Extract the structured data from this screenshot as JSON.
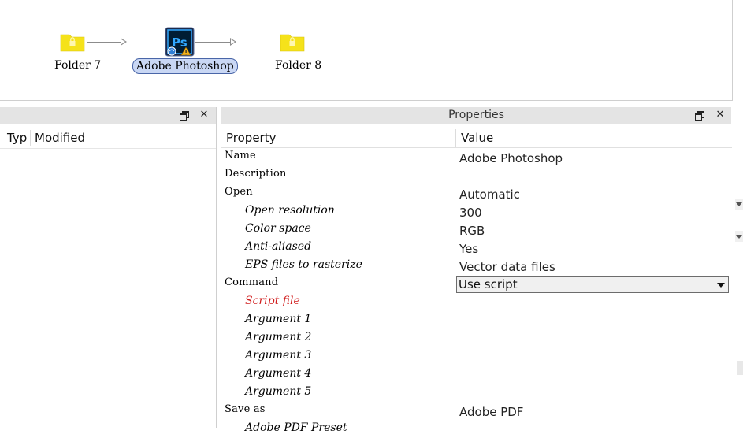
{
  "flow": {
    "nodes": [
      {
        "label": "Folder 7",
        "icon": "folder-lock-icon"
      },
      {
        "label": "Adobe Photoshop",
        "icon": "photoshop-app-icon",
        "selected": true
      },
      {
        "label": "Folder 8",
        "icon": "folder-lock-icon"
      }
    ],
    "folder_color": "#f5e21a",
    "selection_color": "#c9d7f4"
  },
  "left_panel": {
    "columns": [
      "Typ",
      "Modified"
    ]
  },
  "properties_panel": {
    "title": "Properties",
    "col_property": "Property",
    "col_value": "Value",
    "rows": [
      {
        "name": "Name",
        "value": "Adobe Photoshop",
        "kind": "group"
      },
      {
        "name": "Description",
        "value": "",
        "kind": "group"
      },
      {
        "name": "Open",
        "value": "Automatic",
        "kind": "group"
      },
      {
        "name": "Open resolution",
        "value": "300",
        "kind": "child"
      },
      {
        "name": "Color space",
        "value": "RGB",
        "kind": "child"
      },
      {
        "name": "Anti-aliased",
        "value": "Yes",
        "kind": "child"
      },
      {
        "name": "EPS files to rasterize",
        "value": "Vector data files",
        "kind": "child"
      },
      {
        "name": "Command",
        "value": "Use script",
        "kind": "group",
        "dropdown": true
      },
      {
        "name": "Script file",
        "value": "",
        "kind": "child",
        "error": true
      },
      {
        "name": "Argument 1",
        "value": "",
        "kind": "child"
      },
      {
        "name": "Argument 2",
        "value": "",
        "kind": "child"
      },
      {
        "name": "Argument 3",
        "value": "",
        "kind": "child"
      },
      {
        "name": "Argument 4",
        "value": "",
        "kind": "child"
      },
      {
        "name": "Argument 5",
        "value": "",
        "kind": "child"
      },
      {
        "name": "Save as",
        "value": "Adobe PDF",
        "kind": "group"
      },
      {
        "name": "Adobe PDF Preset",
        "value": "",
        "kind": "child"
      }
    ],
    "error_color": "#d01c1c"
  }
}
